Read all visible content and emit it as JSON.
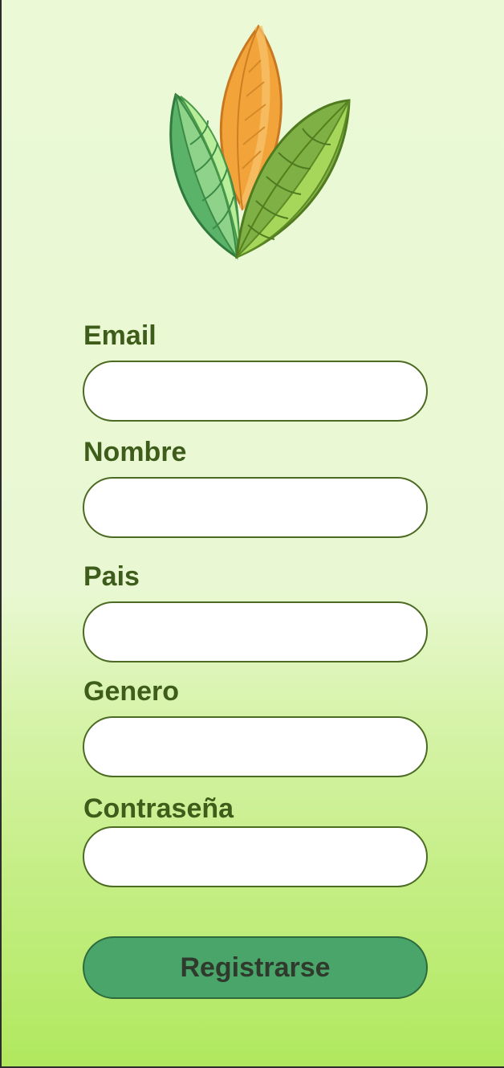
{
  "form": {
    "email_label": "Email",
    "email_value": "",
    "nombre_label": "Nombre",
    "nombre_value": "",
    "pais_label": "Pais",
    "pais_value": "",
    "genero_label": "Genero",
    "genero_value": "",
    "password_label": "Contraseña",
    "password_value": "",
    "submit_label": "Registrarse"
  },
  "logo": {
    "icon": "leaves-logo-icon"
  },
  "colors": {
    "label_text": "#3f5d1a",
    "input_border": "#4b6a22",
    "button_fill": "#4aa56a",
    "button_text": "#2f3a2c",
    "background_top": "#ebf9d6",
    "background_bottom": "#b0e85e"
  }
}
